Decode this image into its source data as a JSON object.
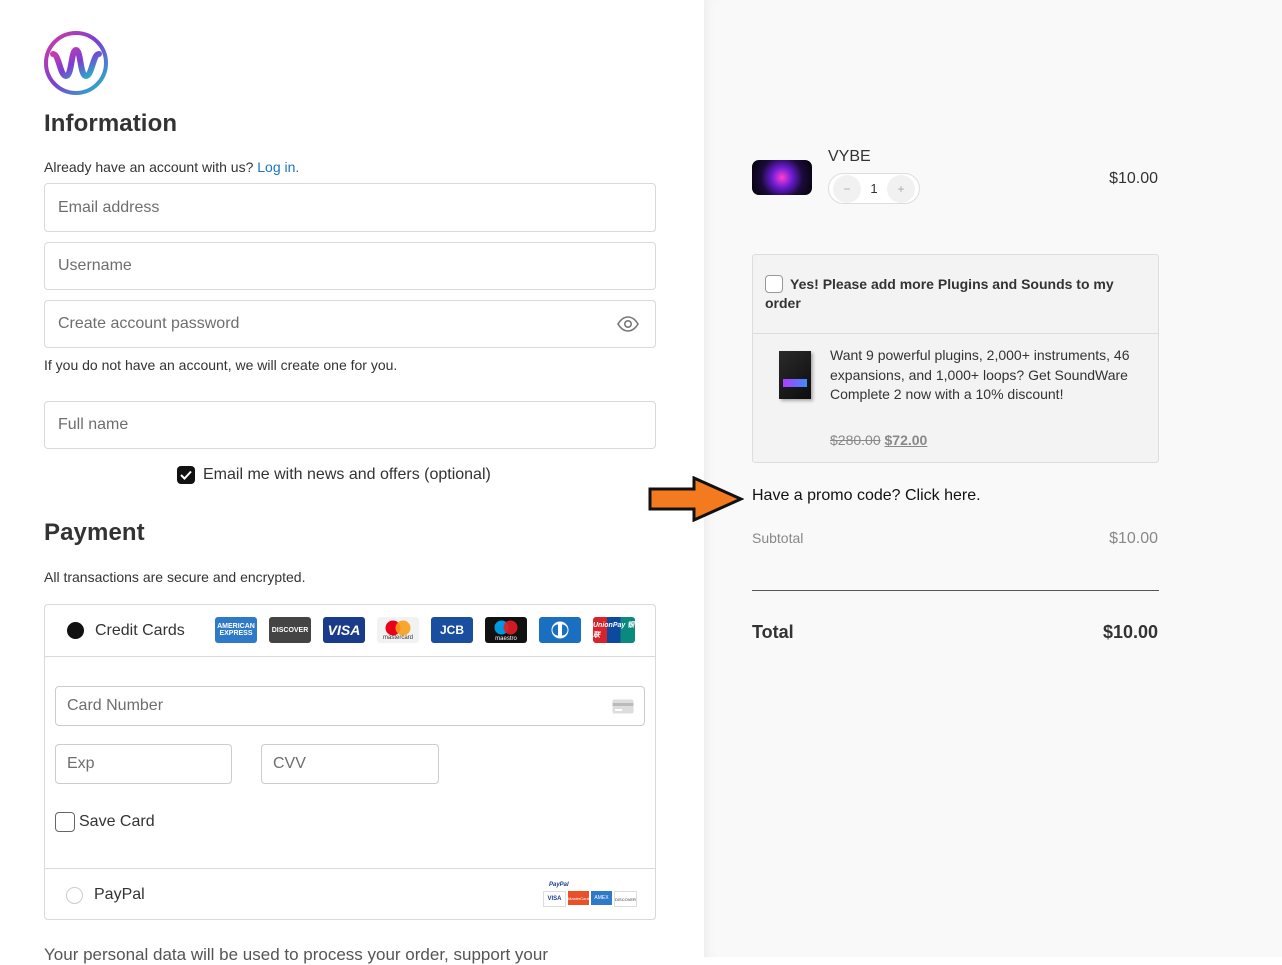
{
  "brand": {
    "logo_icon": "wave-w-logo-icon"
  },
  "information": {
    "heading": "Information",
    "account_prompt": "Already have an account with us?",
    "login_link": "Log in.",
    "email_placeholder": "Email address",
    "username_placeholder": "Username",
    "password_placeholder": "Create account password",
    "account_note": "If you do not have an account, we will create one for you.",
    "fullname_placeholder": "Full name",
    "newsletter_label": "Email me with news and offers (optional)",
    "newsletter_checked": true
  },
  "payment": {
    "heading": "Payment",
    "note": "All transactions are secure and encrypted.",
    "credit_label": "Credit Cards",
    "card_brands": [
      "AMERICAN EXPRESS",
      "DISCOVER",
      "VISA",
      "mastercard",
      "JCB",
      "maestro",
      "Diners",
      "UnionPay 银联"
    ],
    "card_number_placeholder": "Card Number",
    "exp_placeholder": "Exp",
    "cvv_placeholder": "CVV",
    "save_card_label": "Save Card",
    "paypal_label": "PayPal",
    "paypal_logos": [
      "PayPal",
      "VISA",
      "MasterCard",
      "AMEX",
      "DISCOVER"
    ],
    "privacy_text": "Your personal data will be used to process your order, support your"
  },
  "order": {
    "product_name": "VYBE",
    "quantity": "1",
    "qty_minus": "−",
    "qty_plus": "+",
    "price": "$10.00",
    "upsell_title": "Yes! Please add more Plugins and Sounds to my order",
    "upsell_desc": "Want 9 powerful plugins, 2,000+ instruments, 46 expansions, and 1,000+ loops? Get SoundWare Complete 2 now with a 10% discount!",
    "upsell_old_price": "$280.00",
    "upsell_new_price": "$72.00",
    "promo_text": "Have a promo code? Click here.",
    "subtotal_label": "Subtotal",
    "subtotal_value": "$10.00",
    "total_label": "Total",
    "total_value": "$10.00"
  },
  "colors": {
    "link": "#1a73c8",
    "arrow_fill": "#f47a20",
    "accent_dark": "#111111"
  }
}
